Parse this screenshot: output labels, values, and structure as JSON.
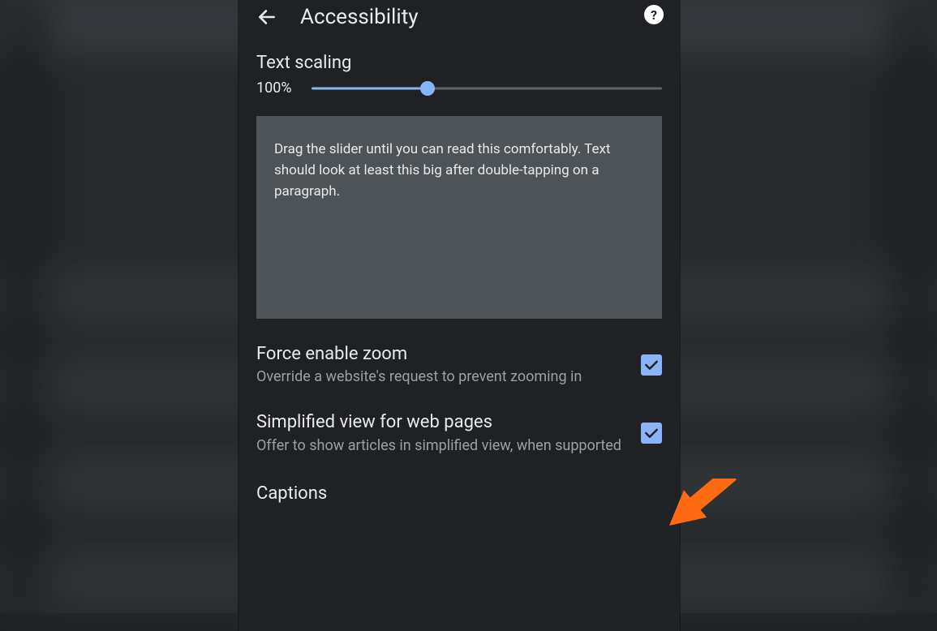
{
  "header": {
    "title": "Accessibility"
  },
  "text_scaling": {
    "label": "Text scaling",
    "value": "100%",
    "preview": "Drag the slider until you can read this comfortably. Text should look at least this big after double-tapping on a paragraph."
  },
  "settings": {
    "force_zoom": {
      "title": "Force enable zoom",
      "subtitle": "Override a website's request to prevent zooming in",
      "checked": true
    },
    "simplified_view": {
      "title": "Simplified view for web pages",
      "subtitle": "Offer to show articles in simplified view, when supported",
      "checked": true
    },
    "captions": {
      "title": "Captions"
    }
  }
}
